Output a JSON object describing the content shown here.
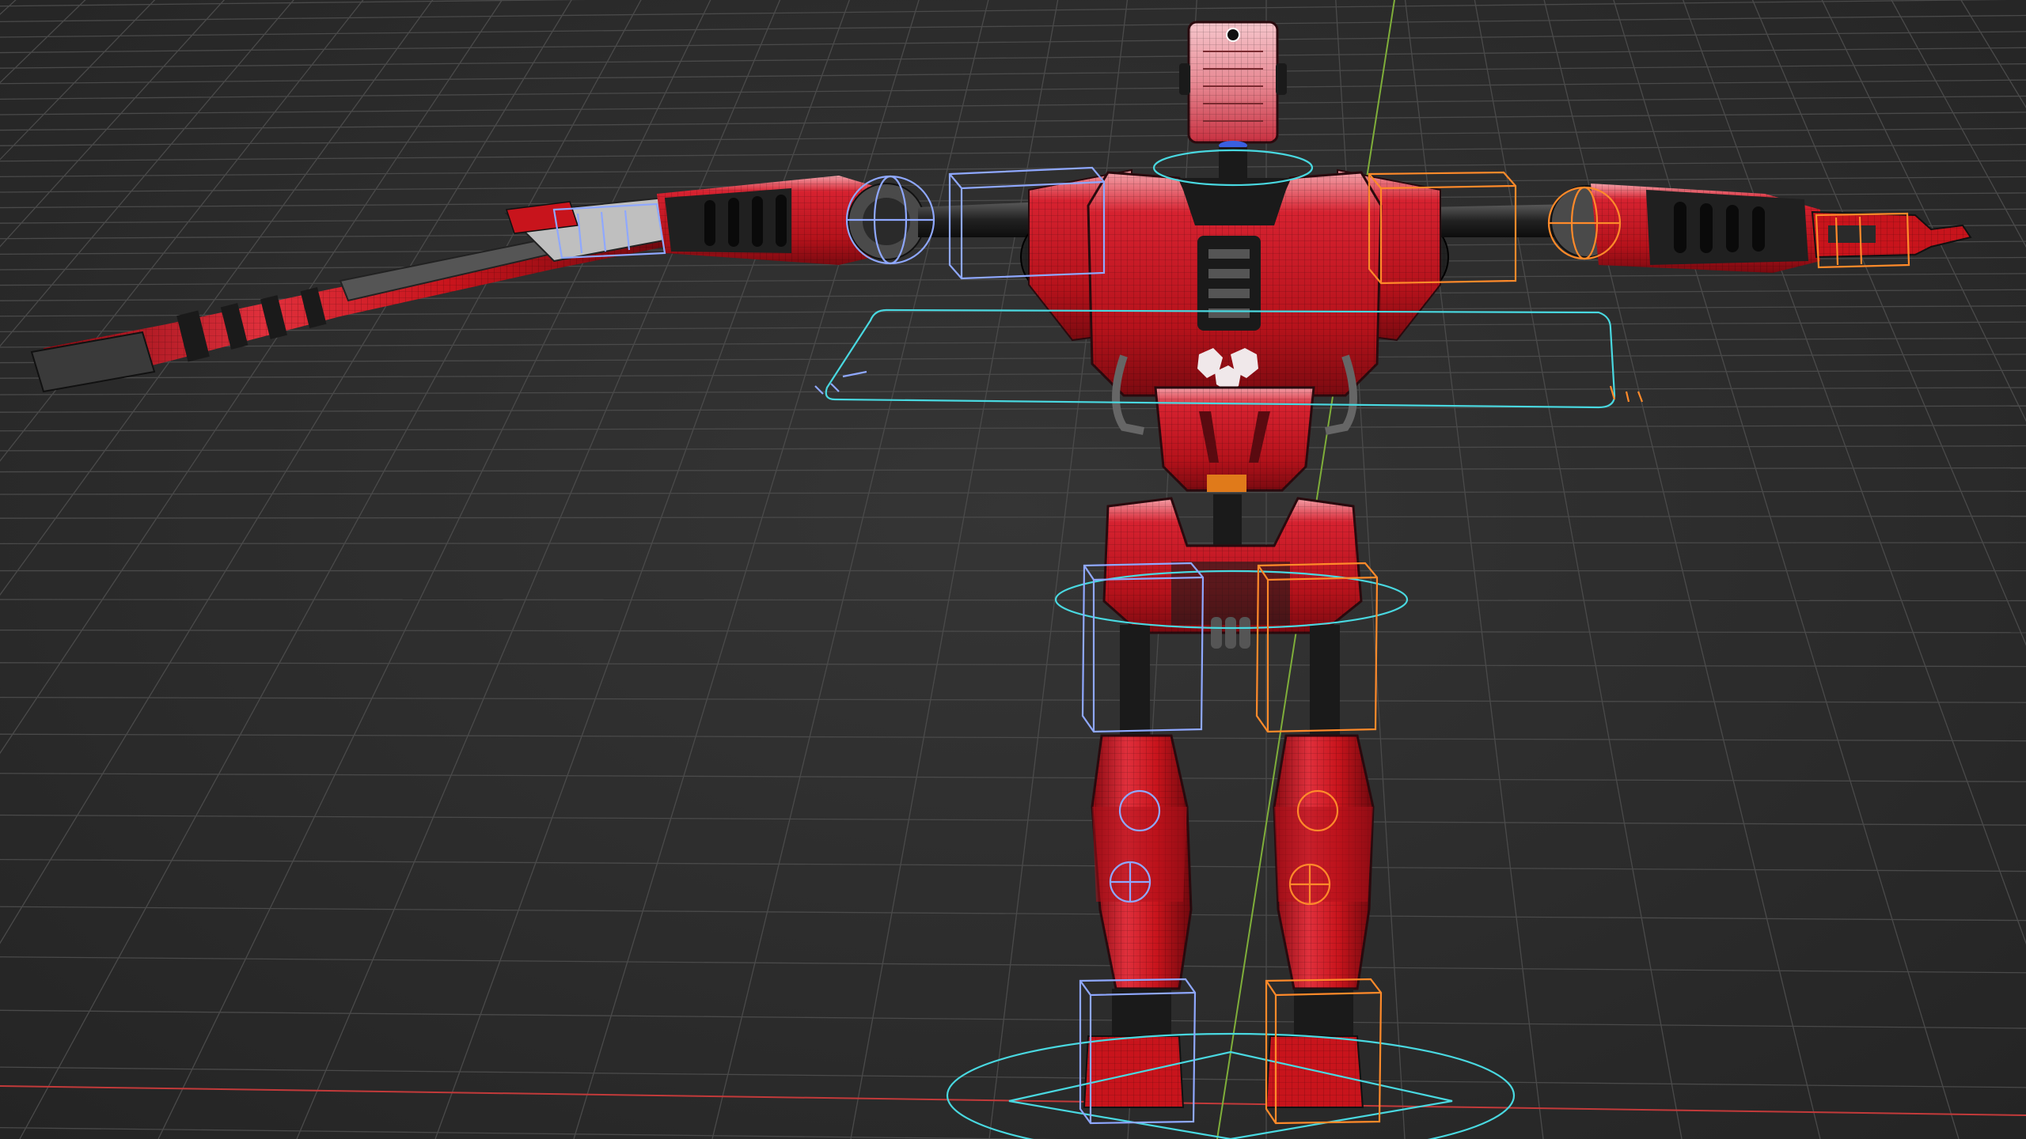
{
  "viewport": {
    "type": "3d-viewport",
    "background_color": "#2b2b2b",
    "grid_color": "#4a4a4a",
    "x_axis_color": "#c23a3a",
    "y_axis_color": "#7fae3a"
  },
  "scene": {
    "object": "robot-character-rig",
    "pose": "T-pose",
    "display": "solid-with-wireframe-overlay",
    "colors": {
      "body": "#c8141c",
      "body_highlight": "#f05060",
      "dark_joint": "#1a1a1a",
      "wire": "#000000",
      "control_left": "#8fa8ff",
      "control_right": "#ff8a2a",
      "control_center": "#49d8e0"
    },
    "rig_controls": [
      "head-control",
      "root-control",
      "hips-control",
      "chest-control",
      "shoulder-controls",
      "hand-controls",
      "knee-controls",
      "foot-controls"
    ],
    "logo": "chest-logo"
  }
}
